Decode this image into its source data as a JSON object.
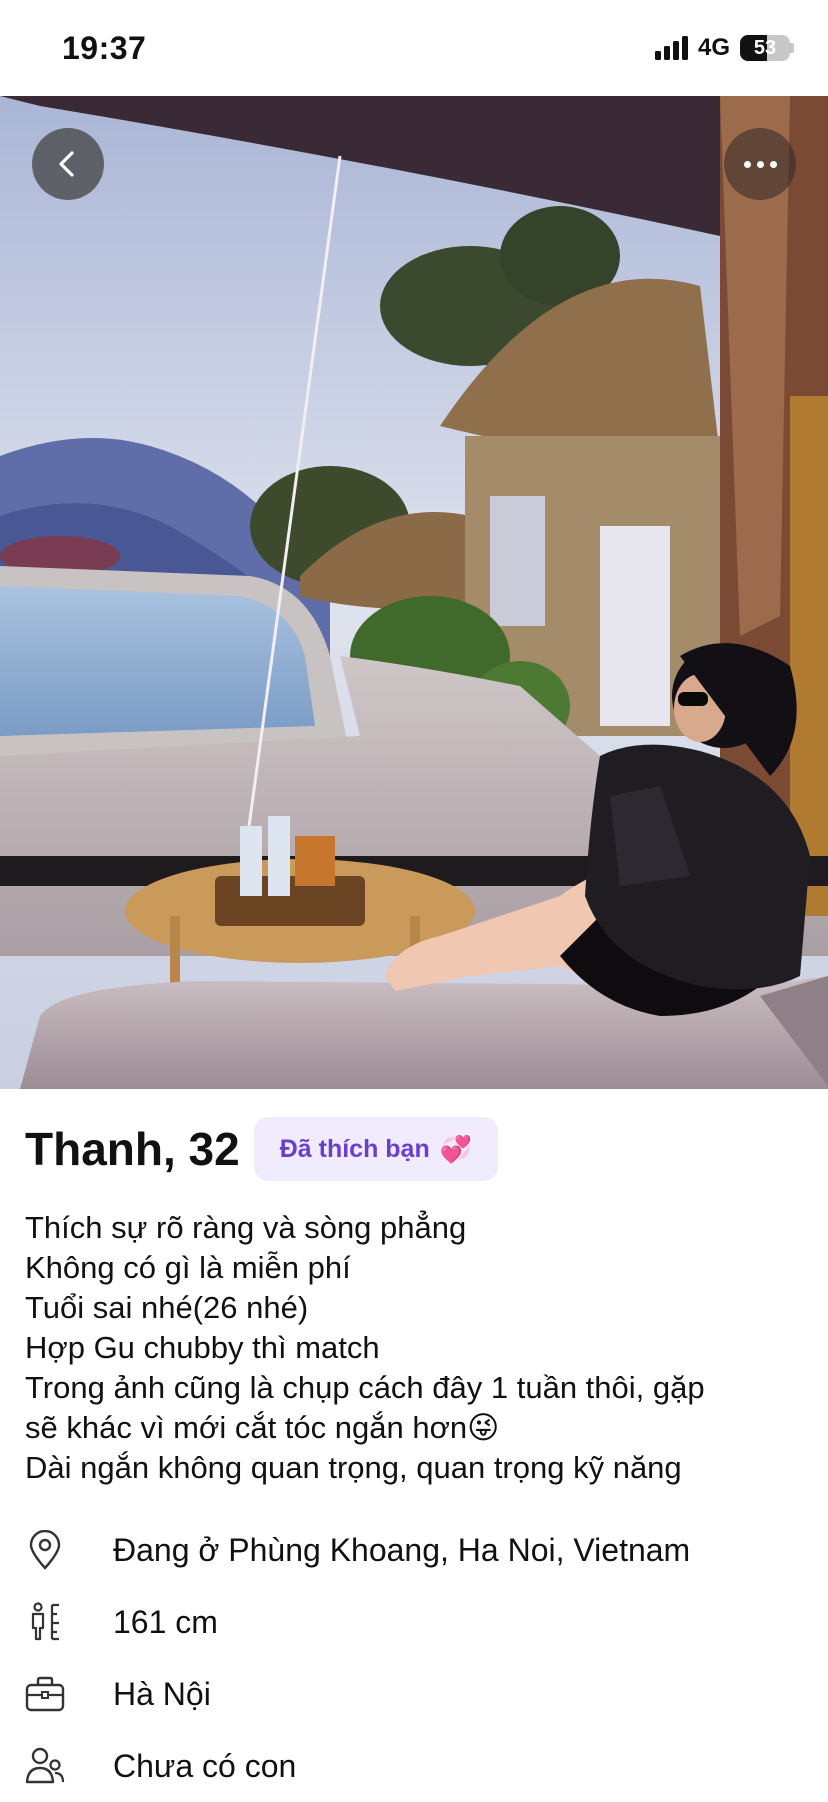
{
  "status_bar": {
    "time": "19:37",
    "network": "4G",
    "battery": "53",
    "battery_level": 0.53
  },
  "photo": {
    "back_icon": "chevron-left-icon",
    "more_icon": "ellipsis-icon"
  },
  "profile": {
    "name_age": "Thanh, 32",
    "liked_badge": "Đã thích bạn",
    "liked_emoji": "💞",
    "bio_lines": [
      "Thích sự rõ ràng và sòng phẳng",
      "Không có gì là miễn phí",
      "Tuổi sai nhé(26 nhé)",
      "Hợp Gu chubby thì match",
      "Trong ảnh cũng là chụp cách đây 1 tuần thôi, gặp",
      "sẽ khác vì mới cắt tóc ngắn hơn😜",
      "Dài ngắn không quan trọng, quan trọng kỹ năng"
    ],
    "info": [
      {
        "icon": "location-pin-icon",
        "text": "Đang ở Phùng Khoang, Ha Noi, Vietnam"
      },
      {
        "icon": "height-icon",
        "text": "161 cm"
      },
      {
        "icon": "briefcase-icon",
        "text": "Hà Nội"
      },
      {
        "icon": "people-icon",
        "text": "Chưa có con"
      }
    ]
  }
}
